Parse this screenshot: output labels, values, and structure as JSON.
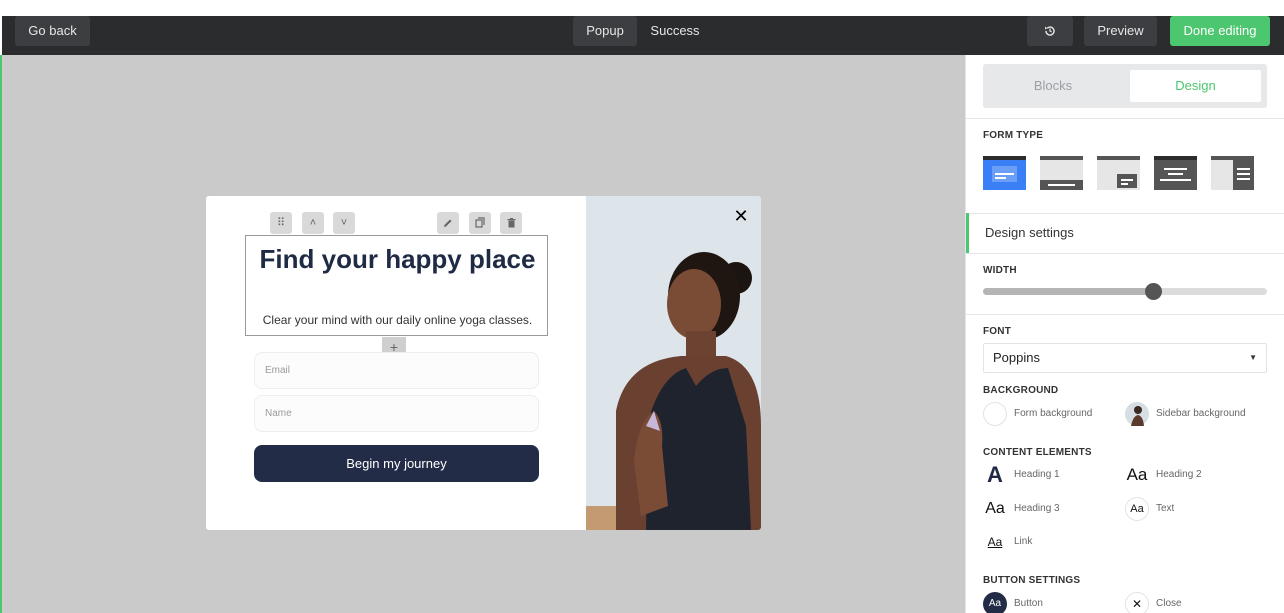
{
  "topbar": {
    "go_back": "Go back",
    "tab_popup": "Popup",
    "tab_success": "Success",
    "history_icon": "history-icon",
    "preview": "Preview",
    "done": "Done editing"
  },
  "popup": {
    "heading": "Find your happy place",
    "subtext": "Clear your mind with our daily online yoga classes.",
    "email_placeholder": "Email",
    "name_placeholder": "Name",
    "cta": "Begin my journey",
    "close_symbol": "✕",
    "plus_symbol": "+"
  },
  "sidebar": {
    "tabs": [
      "Blocks",
      "Design"
    ],
    "active_tab": "Design",
    "form_type_label": "FORM TYPE",
    "design_settings": "Design settings",
    "width_label": "WIDTH",
    "width_value_fraction": 0.6,
    "font_label": "FONT",
    "font_value": "Poppins",
    "background_label": "BACKGROUND",
    "background": [
      "Form background",
      "Sidebar background"
    ],
    "content_label": "CONTENT ELEMENTS",
    "content": [
      "Heading 1",
      "Heading 2",
      "Heading 3",
      "Text",
      "Link"
    ],
    "button_label": "BUTTON SETTINGS",
    "buttons": [
      "Button",
      "Close"
    ]
  },
  "colors": {
    "accent": "#4cc66f",
    "topbar": "#2b2c2e",
    "navy": "#232c47",
    "canvas": "#cacaca"
  }
}
